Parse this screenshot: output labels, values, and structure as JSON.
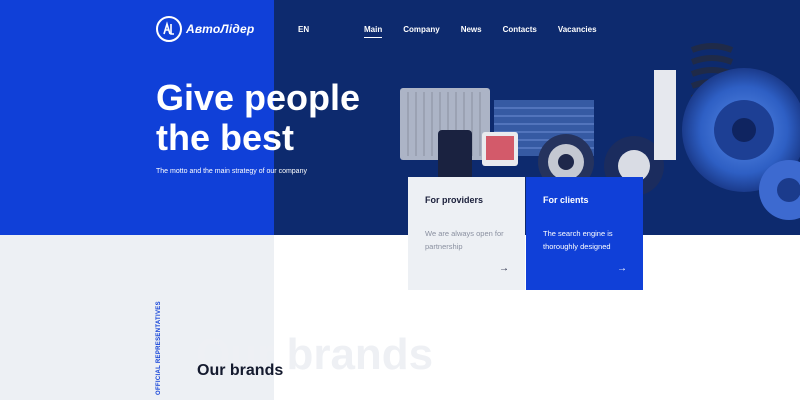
{
  "header": {
    "logo_text": "АвтоЛідер",
    "lang": "EN",
    "nav": [
      {
        "label": "Main"
      },
      {
        "label": "Company"
      },
      {
        "label": "News"
      },
      {
        "label": "Contacts"
      },
      {
        "label": "Vacancies"
      }
    ]
  },
  "hero": {
    "title": "Give people the best",
    "subtitle": "The motto and the main strategy of our company"
  },
  "cards": [
    {
      "title": "For providers",
      "description": "We are always open for partnership",
      "arrow": "→"
    },
    {
      "title": "For clients",
      "description": "The search engine is thoroughly designed",
      "arrow": "→"
    }
  ],
  "brands": {
    "side_label": "OFFICIAL REPRESENTATIVES",
    "watermark": "Our brands",
    "title": "Our brands"
  },
  "colors": {
    "brand_blue": "#1040d8",
    "hero_navy": "#0d2a6e",
    "panel_gray": "#edf0f4"
  }
}
